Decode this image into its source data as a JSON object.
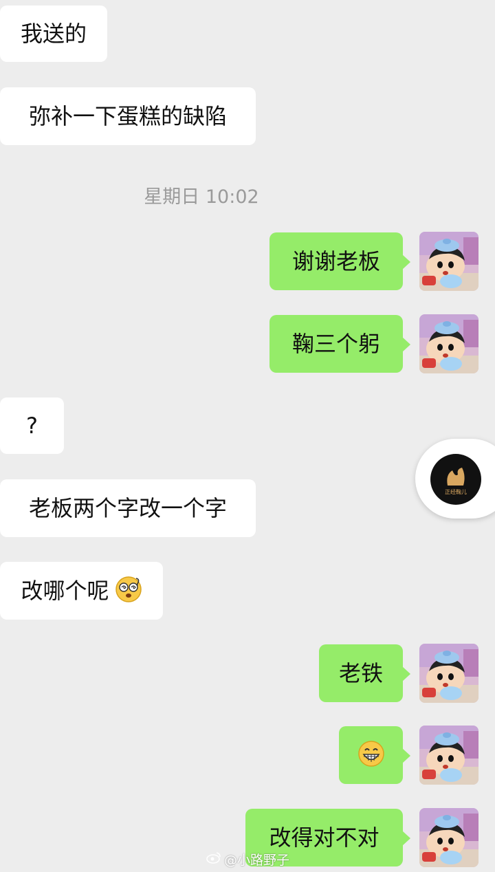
{
  "messages": [
    {
      "side": "in",
      "text": "我送的"
    },
    {
      "side": "in",
      "text": "弥补一下蛋糕的缺陷"
    },
    {
      "side": "out",
      "text": "谢谢老板"
    },
    {
      "side": "out",
      "text": "鞠三个躬"
    },
    {
      "side": "in",
      "text": "?"
    },
    {
      "side": "in",
      "text": "老板两个字改一个字"
    },
    {
      "side": "in",
      "text": "改哪个呢",
      "emoji": "dizzy-face-emoji"
    },
    {
      "side": "out",
      "text": "老铁"
    },
    {
      "side": "out",
      "text": "",
      "emoji": "grinning-face-emoji"
    },
    {
      "side": "out",
      "text": "改得对不对"
    }
  ],
  "timestamp": "星期日 10:02",
  "floating_button": {
    "icon": "video-channel-icon",
    "caption": "正经鞠儿"
  },
  "watermark": "@小路野子",
  "colors": {
    "background": "#ededed",
    "incoming_bubble": "#ffffff",
    "outgoing_bubble": "#95ec69",
    "timestamp_text": "#9a9a9a"
  }
}
